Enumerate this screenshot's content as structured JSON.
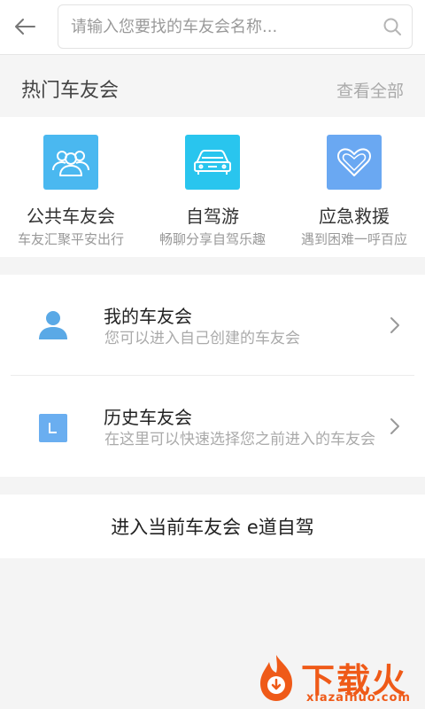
{
  "header": {
    "back_icon": "arrow-left-icon",
    "search_placeholder": "请输入您要找的车友会名称...",
    "search_icon": "search-icon"
  },
  "hot": {
    "title": "热门车友会",
    "see_all": "查看全部"
  },
  "categories": [
    {
      "label": "公共车友会",
      "desc": "车友汇聚平安出行",
      "icon": "group-icon",
      "color": "#4ab8f0"
    },
    {
      "label": "自驾游",
      "desc": "畅聊分享自驾乐趣",
      "icon": "car-icon",
      "color": "#29c5ee"
    },
    {
      "label": "应急救援",
      "desc": "遇到困难一呼百应",
      "icon": "heart-icon",
      "color": "#6aa8f2"
    }
  ],
  "list": [
    {
      "title": "我的车友会",
      "subtitle": "您可以进入自己创建的车友会",
      "icon": "person-icon"
    },
    {
      "title": "历史车友会",
      "subtitle": "在这里可以快速选择您之前进入的车友会",
      "icon": "history-icon"
    }
  ],
  "enter_current": "进入当前车友会 e道自驾",
  "watermark": {
    "text": "下载火",
    "url": "xiazaihuo.com"
  },
  "colors": {
    "accent": "#4ab8f0",
    "watermark": "#ef5a18"
  }
}
